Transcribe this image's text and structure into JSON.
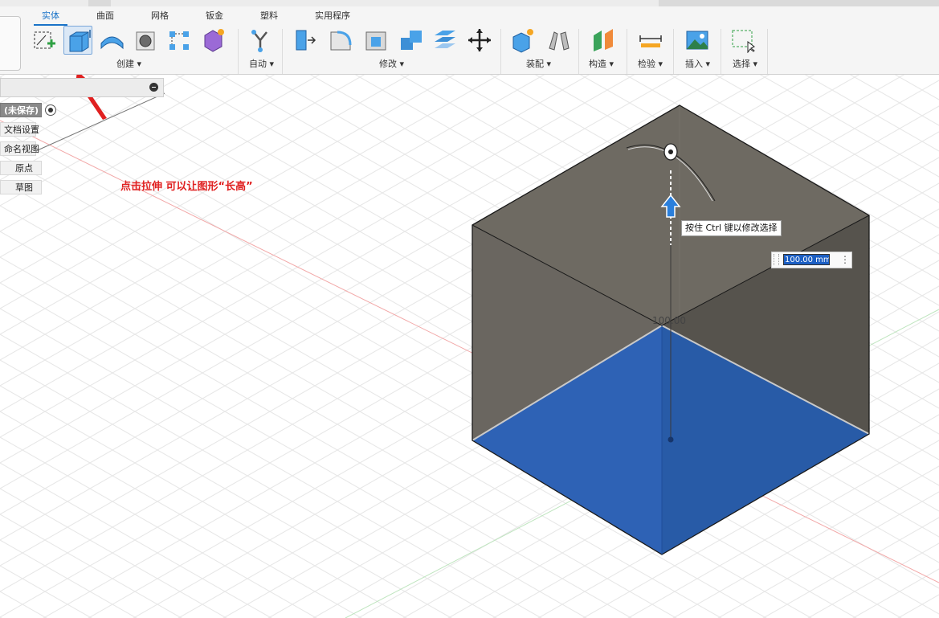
{
  "ribbon": {
    "tabs": [
      {
        "label": "实体",
        "active": true
      },
      {
        "label": "曲面"
      },
      {
        "label": "网格"
      },
      {
        "label": "钣金"
      },
      {
        "label": "塑料"
      },
      {
        "label": "实用程序"
      }
    ],
    "groups": {
      "create": "创建 ▾",
      "automate": "自动 ▾",
      "modify": "修改 ▾",
      "assemble": "装配 ▾",
      "construct": "构造 ▾",
      "inspect": "检验 ▾",
      "insert": "插入 ▾",
      "select": "选择 ▾"
    },
    "tools": [
      {
        "name": "create-sketch"
      },
      {
        "name": "extrude",
        "selected": true
      },
      {
        "name": "revolve"
      },
      {
        "name": "hole"
      },
      {
        "name": "pattern"
      },
      {
        "name": "create-form"
      },
      {
        "name": "automate"
      },
      {
        "name": "press-pull"
      },
      {
        "name": "fillet"
      },
      {
        "name": "shell"
      },
      {
        "name": "combine"
      },
      {
        "name": "replace-face"
      },
      {
        "name": "move"
      },
      {
        "name": "new-component"
      },
      {
        "name": "joint"
      },
      {
        "name": "offset-plane"
      },
      {
        "name": "measure"
      },
      {
        "name": "insert-image"
      },
      {
        "name": "select-window"
      }
    ]
  },
  "browser": {
    "items": [
      {
        "label": "(未保存)"
      },
      {
        "label": "文档设置"
      },
      {
        "label": "命名视图"
      },
      {
        "label": "原点"
      },
      {
        "label": "草图"
      }
    ]
  },
  "canvas": {
    "annotation": "点击拉伸 可以让图形“长高”",
    "tooltip": "按住 Ctrl 键以修改选择",
    "dimension_input": "100.00 mm",
    "dimension_label": "100.00"
  },
  "colors": {
    "accent": "#1a73c8",
    "selected_face": "#2e62b5",
    "body": "#5c5a52",
    "annotation": "#e02020"
  }
}
